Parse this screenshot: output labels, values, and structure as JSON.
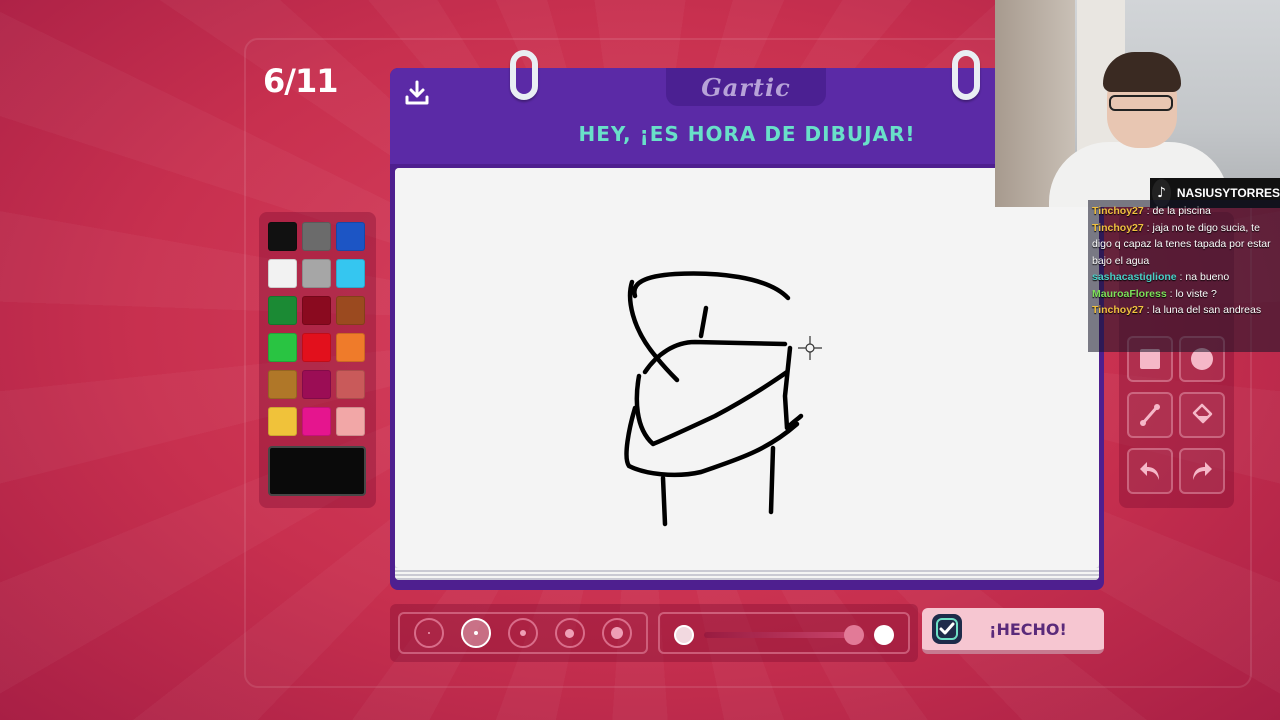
{
  "round": {
    "counter": "6/11"
  },
  "header": {
    "logo": "Gartic",
    "heading": "HEY, ¡ES HORA DE DIBUJAR!",
    "download_icon": "download-icon"
  },
  "palette": {
    "colors": [
      "#111111",
      "#6b6b6b",
      "#1c55c5",
      "#f2f2f2",
      "#a6a6a6",
      "#35c6f0",
      "#1b8a34",
      "#8a0a1f",
      "#9b4a1f",
      "#29c442",
      "#e2101c",
      "#ef7b2a",
      "#b07728",
      "#9b0d55",
      "#c95a5a",
      "#f0c23a",
      "#e5158e",
      "#f2a7a7"
    ],
    "current": "#0a0a0a"
  },
  "tools": {
    "icons": [
      "rectangle-icon",
      "circle-icon",
      "line-icon",
      "bucket-fill-icon",
      "undo-icon",
      "redo-icon"
    ]
  },
  "brush": {
    "sizes": [
      2,
      4,
      6,
      9,
      12
    ],
    "active_size_index": 1,
    "opacity_level": 0.95
  },
  "done_button": {
    "label": "¡HECHO!",
    "icon": "check-icon"
  },
  "stream": {
    "channel": "NASIUSYTORRES",
    "chat": [
      {
        "user": "Tinchoy27",
        "text": " : de la piscina",
        "color": "#f0c040"
      },
      {
        "user": "Tinchoy27",
        "text": " : jaja no te digo sucia, te digo q capaz la tenes tapada por estar bajo el agua",
        "color": "#f0c040"
      },
      {
        "user": "sashacastiglione",
        "text": " : na bueno",
        "color": "#4ad0c8"
      },
      {
        "user": "MauroaFloress",
        "text": " : lo viste ?",
        "color": "#7ee05a"
      },
      {
        "user": "Tinchoy27",
        "text": " : la luna del san andreas",
        "color": "#f0c040"
      }
    ]
  }
}
